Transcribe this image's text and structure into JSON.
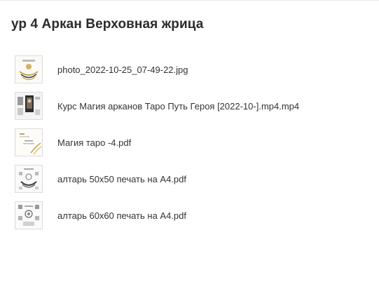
{
  "folder": {
    "title": "ур 4 Аркан Верховная жрица"
  },
  "files": [
    {
      "name": "photo_2022-10-25_07-49-22.jpg",
      "icon": "image-thumbnail-icon"
    },
    {
      "name": "Курс Магия арканов Таро Путь Героя [2022-10-].mp4.mp4",
      "icon": "video-thumbnail-icon"
    },
    {
      "name": "Магия таро -4.pdf",
      "icon": "pdf-thumbnail-icon"
    },
    {
      "name": "алтарь 50x50 печать на А4.pdf",
      "icon": "pdf-thumbnail-icon"
    },
    {
      "name": "алтарь 60x60 печать на А4.pdf",
      "icon": "pdf-thumbnail-icon"
    }
  ],
  "colors": {
    "gold": "#c9a24a",
    "dark": "#3a3a3a"
  }
}
